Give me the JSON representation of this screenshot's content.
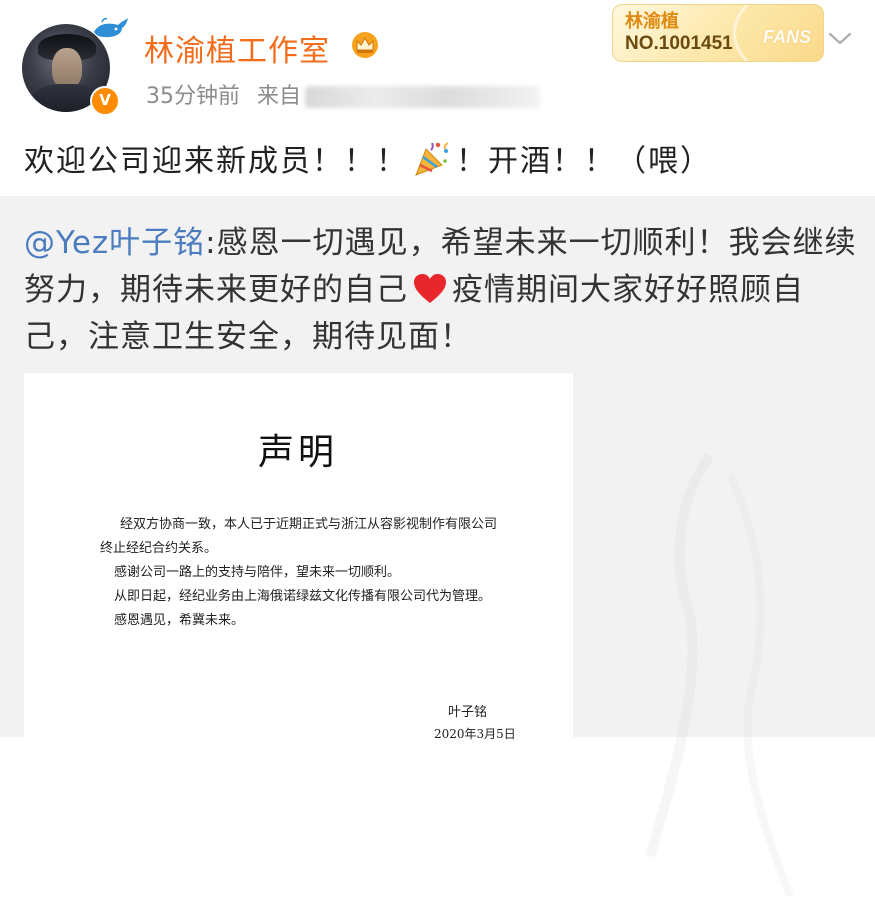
{
  "header": {
    "account_name": "林渝植工作室",
    "time": "35分钟前",
    "source_prefix": "来自",
    "verified_mark": "V",
    "fans_badge": {
      "name": "林渝植",
      "number": "NO.1001451",
      "label": "FANS"
    }
  },
  "post": {
    "text_before": "欢迎公司迎来新成员！！！",
    "text_after": "！开酒！！（喂）",
    "emoji": "party-popper-icon"
  },
  "repost": {
    "mention": "@Yez叶子铭",
    "text_part1": ":感恩一切遇见，希望未来一切顺利！我会继续努力，期待未来更好的自己",
    "text_part2": "疫情期间大家好好照顾自己，注意卫生安全，期待见面！",
    "heart_icon": "red-heart-icon"
  },
  "document": {
    "title": "声明",
    "lines": [
      "经双方协商一致，本人已于近期正式与浙江从容影视制作有限公司",
      "终止经纪合约关系。",
      "感谢公司一路上的支持与陪伴，望未来一切顺利。",
      "从即日起，经纪业务由上海俄诺绿兹文化传播有限公司代为管理。",
      "感恩遇见，希冀未来。"
    ],
    "signature": "叶子铭",
    "date": "2020年3月5日"
  },
  "colors": {
    "name": "#f26c1b",
    "mention": "#4b7cc0",
    "repost_bg": "#f2f2f2",
    "meta": "#8c8c8c"
  }
}
